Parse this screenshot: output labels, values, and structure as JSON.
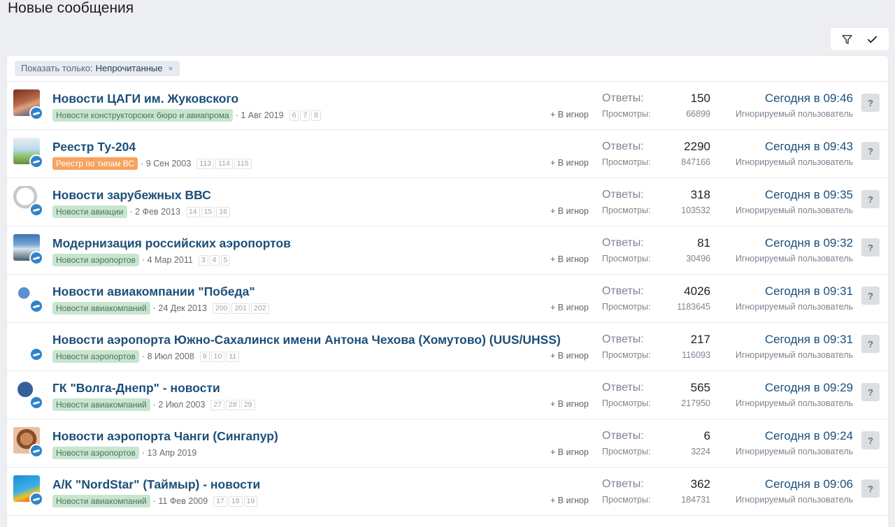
{
  "page_title": "Новые сообщения",
  "filter": {
    "label": "Показать только:",
    "value": "Непрочитанные",
    "remove": "×"
  },
  "toolbar": {
    "filter_icon": "filter-icon",
    "mark_read_icon": "check-icon"
  },
  "labels": {
    "replies": "Ответы:",
    "views": "Просмотры:",
    "ignore": "+ В игнор",
    "help": "?"
  },
  "threads": [
    {
      "title": "Новости ЦАГИ им. Жуковского",
      "forum": "Новости конструкторских бюро и авиапрома",
      "forum_color": "green",
      "date": "· 1 Авг 2019",
      "pages": [
        "6",
        "7",
        "8"
      ],
      "replies": "150",
      "views": "66899",
      "last_date": "Сегодня в 09:46",
      "last_user": "Игнорируемый пользователь",
      "avatar": "av1"
    },
    {
      "title": "Реестр Ту-204",
      "forum": "Реестр по типам ВС",
      "forum_color": "orange",
      "date": "· 9 Сен 2003",
      "pages": [
        "113",
        "114",
        "115"
      ],
      "replies": "2290",
      "views": "847166",
      "last_date": "Сегодня в 09:43",
      "last_user": "Игнорируемый пользователь",
      "avatar": "av2"
    },
    {
      "title": "Новости зарубежных ВВС",
      "forum": "Новости авиации",
      "forum_color": "green",
      "date": "· 2 Фев 2013",
      "pages": [
        "14",
        "15",
        "16"
      ],
      "replies": "318",
      "views": "103532",
      "last_date": "Сегодня в 09:35",
      "last_user": "Игнорируемый пользователь",
      "avatar": "av3"
    },
    {
      "title": "Модернизация российских аэропортов",
      "forum": "Новости аэропортов",
      "forum_color": "green",
      "date": "· 4 Мар 2011",
      "pages": [
        "3",
        "4",
        "5"
      ],
      "replies": "81",
      "views": "30496",
      "last_date": "Сегодня в 09:32",
      "last_user": "Игнорируемый пользователь",
      "avatar": "av4"
    },
    {
      "title": "Новости авиакомпании \"Победа\"",
      "forum": "Новости авиакомпаний",
      "forum_color": "green",
      "date": "· 24 Дек 2013",
      "pages": [
        "200",
        "201",
        "202"
      ],
      "replies": "4026",
      "views": "1183645",
      "last_date": "Сегодня в 09:31",
      "last_user": "Игнорируемый пользователь",
      "avatar": "av5"
    },
    {
      "title": "Новости аэропорта Южно-Сахалинск имени Антона Чехова (Хомутово) (UUS/UHSS)",
      "forum": "Новости аэропортов",
      "forum_color": "green",
      "date": "· 8 Июл 2008",
      "pages": [
        "9",
        "10",
        "11"
      ],
      "replies": "217",
      "views": "116093",
      "last_date": "Сегодня в 09:31",
      "last_user": "Игнорируемый пользователь",
      "avatar": "av6"
    },
    {
      "title": "ГК \"Волга-Днепр\" - новости",
      "forum": "Новости авиакомпаний",
      "forum_color": "green",
      "date": "· 2 Июл 2003",
      "pages": [
        "27",
        "28",
        "29"
      ],
      "replies": "565",
      "views": "217950",
      "last_date": "Сегодня в 09:29",
      "last_user": "Игнорируемый пользователь",
      "avatar": "av7"
    },
    {
      "title": "Новости аэропорта Чанги (Сингапур)",
      "forum": "Новости аэропортов",
      "forum_color": "green",
      "date": "· 13 Апр 2019",
      "pages": [],
      "replies": "6",
      "views": "3224",
      "last_date": "Сегодня в 09:24",
      "last_user": "Игнорируемый пользователь",
      "avatar": "av8"
    },
    {
      "title": "А/К \"NordStar\" (Таймыр) - новости",
      "forum": "Новости авиакомпаний",
      "forum_color": "green",
      "date": "· 11 Фев 2009",
      "pages": [
        "17",
        "18",
        "19"
      ],
      "replies": "362",
      "views": "184731",
      "last_date": "Сегодня в 09:06",
      "last_user": "Игнорируемый пользователь",
      "avatar": "av9"
    }
  ]
}
